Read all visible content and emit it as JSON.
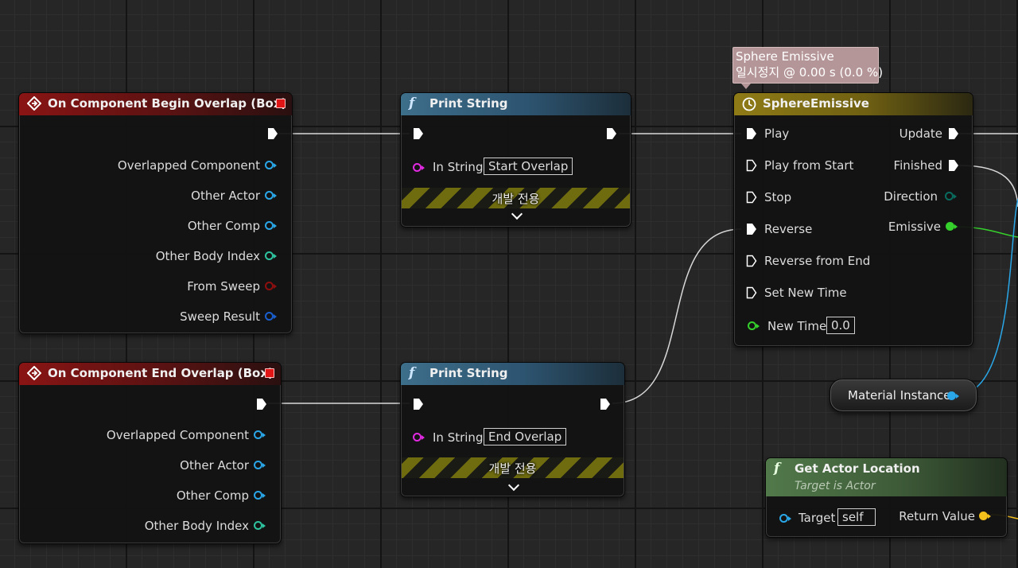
{
  "colors": {
    "exec": "#ffffff",
    "object": "#2aa7e8",
    "integer": "#2ec4a0",
    "boolean": "#8e0f0f",
    "struct": "#1a5fcf",
    "string": "#e22ae2",
    "float": "#35d02c",
    "vector": "#f4c01c",
    "event_header": "#8a1414",
    "function_header": "#3d6e8a",
    "timeline_header": "#8f7b16",
    "pure_header": "#51794a"
  },
  "nodes": {
    "begin_overlap": {
      "title": "On Component Begin Overlap (Box)",
      "icon": "event-diamond-icon",
      "pins": [
        "Overlapped Component",
        "Other Actor",
        "Other Comp",
        "Other Body Index",
        "From Sweep",
        "Sweep Result"
      ]
    },
    "end_overlap": {
      "title": "On Component End Overlap (Box)",
      "icon": "event-diamond-icon",
      "pins": [
        "Overlapped Component",
        "Other Actor",
        "Other Comp",
        "Other Body Index"
      ]
    },
    "print_string_1": {
      "title": "Print String",
      "icon": "function-icon",
      "in_label": "In String",
      "in_value": "Start Overlap",
      "dev_label": "개발 전용"
    },
    "print_string_2": {
      "title": "Print String",
      "icon": "function-icon",
      "in_label": "In String",
      "in_value": "End Overlap",
      "dev_label": "개발 전용"
    },
    "timeline": {
      "title": "SphereEmissive",
      "icon": "clock-icon",
      "tooltip_line1": "Sphere Emissive",
      "tooltip_line2": "일시정지 @ 0.00 s (0.0 %)",
      "inputs": [
        "Play",
        "Play from Start",
        "Stop",
        "Reverse",
        "Reverse from End",
        "Set New Time"
      ],
      "new_time_label": "New Time",
      "new_time_value": "0.0",
      "outputs": [
        "Update",
        "Finished",
        "Direction",
        "Emissive"
      ]
    },
    "material_instance": {
      "label": "Material Instance"
    },
    "get_actor_location": {
      "title": "Get Actor Location",
      "subtitle": "Target is Actor",
      "icon": "function-icon",
      "target_label": "Target",
      "target_value": "self",
      "return_label": "Return Value"
    }
  }
}
